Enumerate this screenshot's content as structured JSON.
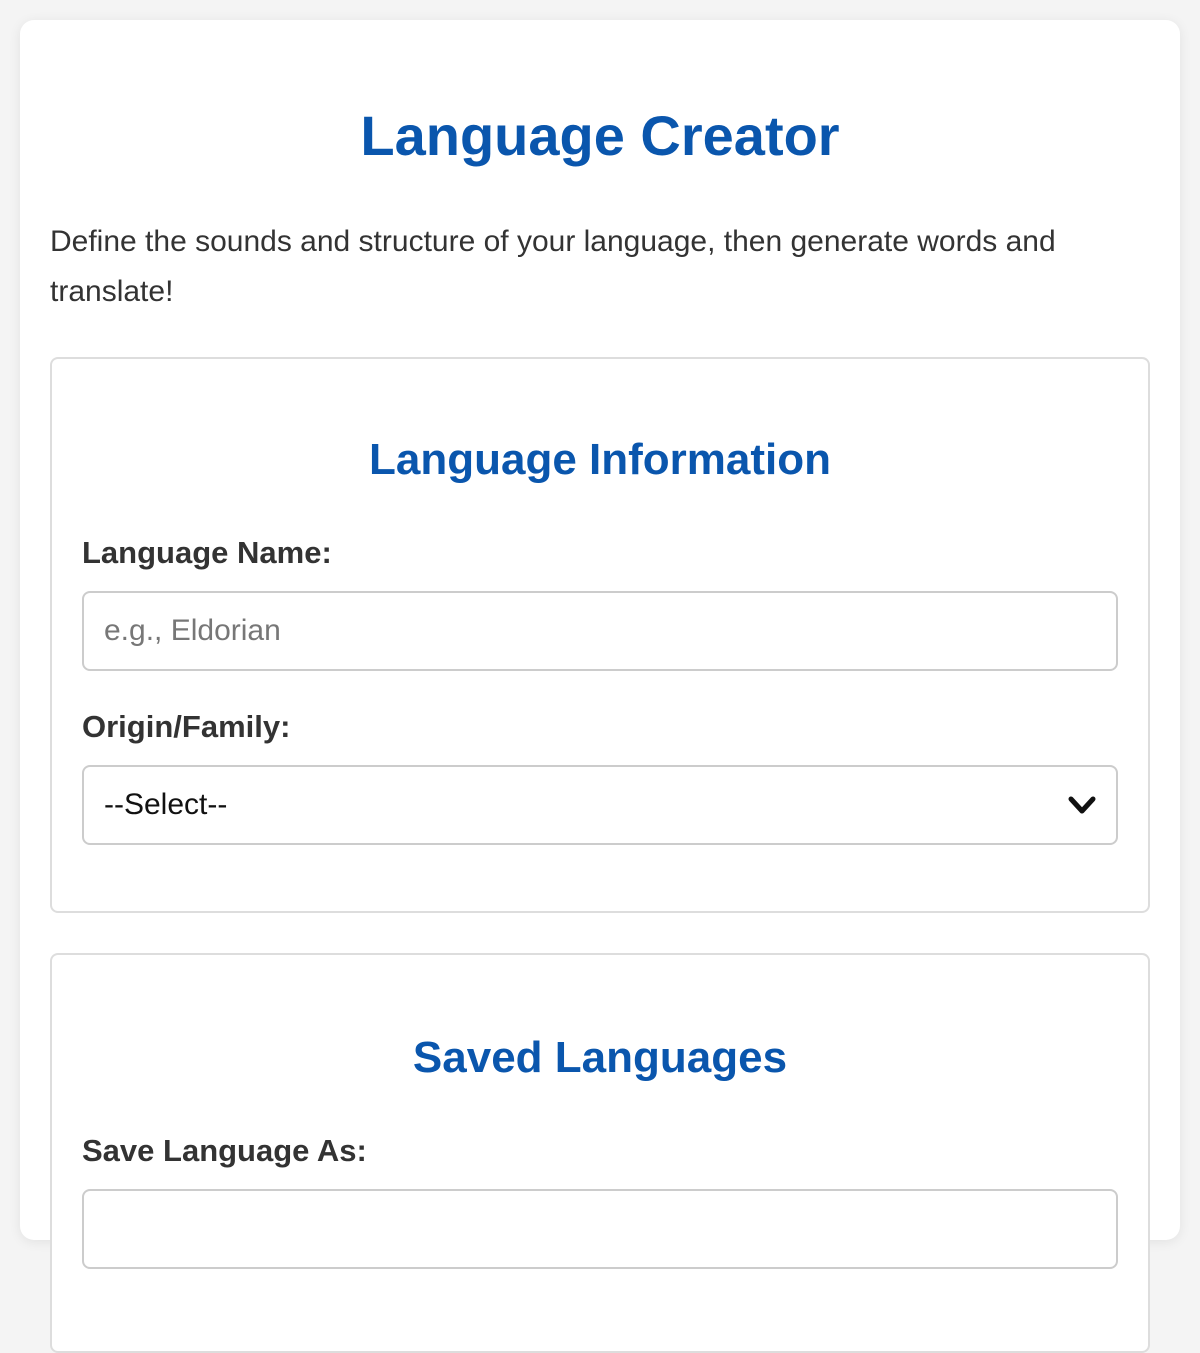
{
  "app": {
    "title": "Language Creator",
    "intro": "Define the sounds and structure of your language, then generate words and translate!"
  },
  "language_info": {
    "heading": "Language Information",
    "name_label": "Language Name:",
    "name_placeholder": "e.g., Eldorian",
    "name_value": "",
    "origin_label": "Origin/Family:",
    "origin_selected": "--Select--"
  },
  "saved_languages": {
    "heading": "Saved Languages",
    "save_as_label": "Save Language As:"
  },
  "colors": {
    "accent": "#0a56ad",
    "text": "#333333",
    "border": "#cccccc"
  },
  "icons": {
    "select_arrow": "chevron-down-icon"
  }
}
